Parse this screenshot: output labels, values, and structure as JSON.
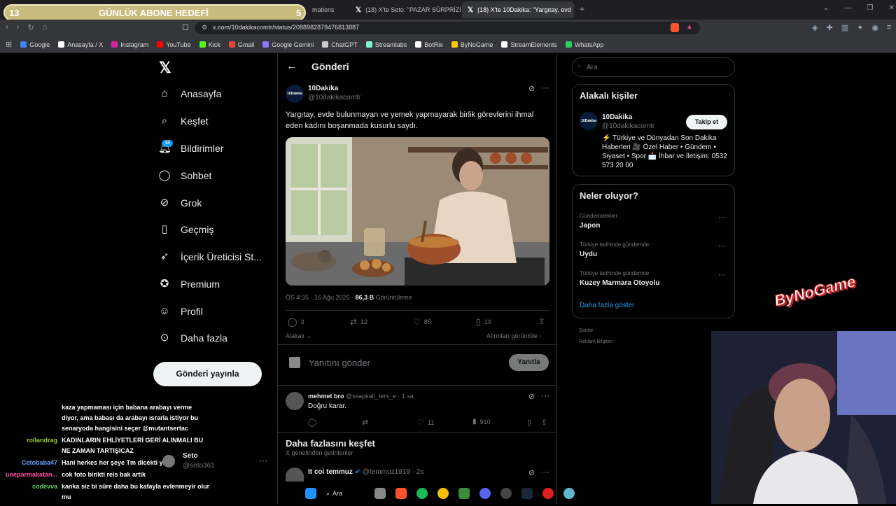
{
  "overlay": {
    "left_num": "13",
    "title": "GÜNLÜK ABONE HEDEFİ",
    "right_num": "5"
  },
  "tabs": [
    {
      "label": "mations"
    },
    {
      "label": "(18) X'te Seto: \"PAZAR SÜRPRİZİ http"
    },
    {
      "label": "(18) X'te 10Dakika: \"Yargıtay, evd"
    }
  ],
  "address": {
    "url": "x.com/10dakikacomtr/status/2088982879476813887"
  },
  "bookmarks": [
    {
      "label": "Google",
      "color": "#4285f4"
    },
    {
      "label": "Anasayfa / X",
      "color": "#ffffff"
    },
    {
      "label": "Instagram",
      "color": "#d6249f"
    },
    {
      "label": "YouTube",
      "color": "#ff0000"
    },
    {
      "label": "Kick",
      "color": "#53fc18"
    },
    {
      "label": "Gmail",
      "color": "#ea4335"
    },
    {
      "label": "Google Gemini",
      "color": "#8e75ff"
    },
    {
      "label": "ChatGPT",
      "color": "#cccccc"
    },
    {
      "label": "Streamlabs",
      "color": "#80f5d2"
    },
    {
      "label": "BotRix",
      "color": "#ffffff"
    },
    {
      "label": "ByNoGame",
      "color": "#ffcc00"
    },
    {
      "label": "StreamElements",
      "color": "#ffffff"
    },
    {
      "label": "WhatsApp",
      "color": "#25d366"
    }
  ],
  "nav": {
    "items": [
      {
        "label": "Anasayfa",
        "icon": "home-icon"
      },
      {
        "label": "Keşfet",
        "icon": "search-icon"
      },
      {
        "label": "Bildirimler",
        "icon": "bell-icon"
      },
      {
        "label": "Sohbet",
        "icon": "chat-icon"
      },
      {
        "label": "Grok",
        "icon": "grok-icon"
      },
      {
        "label": "Geçmiş",
        "icon": "bookmark-icon"
      },
      {
        "label": "İçerik Üreticisi St...",
        "icon": "rocket-icon"
      },
      {
        "label": "Premium",
        "icon": "check-badge-icon"
      },
      {
        "label": "Profil",
        "icon": "person-icon"
      },
      {
        "label": "Daha fazla",
        "icon": "more-circle-icon"
      }
    ],
    "notif_badge": "18",
    "post_button": "Gönderi yayınla"
  },
  "post": {
    "header": "Gönderi",
    "author": "10Dakika",
    "handle": "@10dakikacomtr",
    "avatar_text": "10Dakika",
    "text": "Yargıtay, evde bulunmayan ve yemek yapmayarak birlik görevlerini ihmal eden kadını boşanmada kusurlu saydı.",
    "time": "ÖS 4:35 · 16 Ağu 2026 · ",
    "views": "86,3 B",
    "views_label": " Görüntüleme",
    "replies": "3",
    "reposts": "12",
    "likes": "85",
    "bookmarks": "14",
    "related": "Alakalı",
    "quotes": "Alıntıları görüntüle",
    "reply_placeholder": "Yanıtını gönder",
    "reply_button": "Yanıtla"
  },
  "reply": {
    "author": "mehmet bro",
    "handle": "@ssapkali_ters_e",
    "time": "· 1 sa",
    "text": "Doğru karar.",
    "likes": "11",
    "views": "910"
  },
  "explore": {
    "title": "Daha fazlasını keşfet",
    "subtitle": "X genelinden getirilenler",
    "next_author": "It coi temmuz",
    "next_handle": "@temmuz1919",
    "next_time": "· 2s"
  },
  "right": {
    "search_placeholder": "Ara",
    "people_title": "Alakalı kişiler",
    "person_name": "10Dakika",
    "person_handle": "@10dakikacomtr",
    "follow": "Takip et",
    "bio": "⚡ Türkiye ve Dünyadan Son Dakika Haberleri 🎥 Özel Haber • Gündem • Siyaset • Spor 📩 İhbar ve İletişim: 0532 573 20 00",
    "trends_title": "Neler oluyor?",
    "trends": [
      {
        "context": "Gündemdekiler",
        "name": "Japon"
      },
      {
        "context": "Türkiye tarihinde gündemde",
        "name": "Uydu"
      },
      {
        "context": "Türkiye tarihinde gündemde",
        "name": "Kuzey Marmara Otoyolu"
      }
    ],
    "show_more": "Daha fazla göster",
    "footer1": "Şartlar",
    "footer2": "Reklam Bilgileri"
  },
  "stream": {
    "logo": "ByNoGame",
    "chat": [
      {
        "user": "",
        "user_color": "#ffffff",
        "text": "kaza yapmaması için babana arabayı verme diyor, ama babası da arabayı ısrarla istiyor bu senaryoda hangisini seçer @mutantsertac"
      },
      {
        "user": "rollandrag",
        "user_color": "#9acd32",
        "text": "KADINLARIN EHLİYETLERİ GERİ ALINMALI BU NE ZAMAN TARTIŞICAZ"
      },
      {
        "user": "Cetobaba47",
        "user_color": "#6aa0ff",
        "text": "Hani herkes her şeye Tm dicekti ya"
      },
      {
        "user": "uneparmakatan...",
        "user_color": "#ff4fa0",
        "text": "cok foto birikti reis bak artik"
      },
      {
        "user": "codevva",
        "user_color": "#5fd35f",
        "text": "kanka siz bi süre daha bu kafayla evlenmeyir olur mu"
      }
    ],
    "chat_overlay_name": "Seto",
    "chat_overlay_handle": "@seto361"
  },
  "taskbar": {
    "search": "Ara"
  }
}
